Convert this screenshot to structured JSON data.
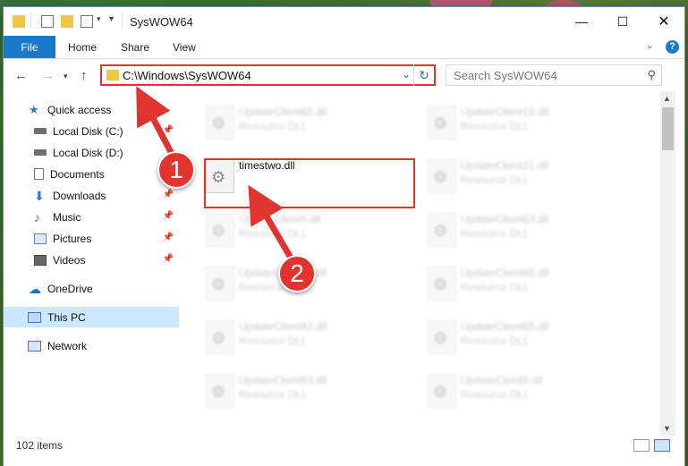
{
  "window": {
    "title": "SysWOW64"
  },
  "ribbon": {
    "tabs": [
      "File",
      "Home",
      "Share",
      "View"
    ]
  },
  "nav": {
    "address": "C:\\Windows\\SysWOW64",
    "search_placeholder": "Search SysWOW64"
  },
  "sidebar": {
    "items": [
      {
        "label": "Quick access",
        "icon": "star-icon"
      },
      {
        "label": "Local Disk (C:)",
        "icon": "drive-icon"
      },
      {
        "label": "Local Disk (D:)",
        "icon": "drive-icon"
      },
      {
        "label": "Documents",
        "icon": "documents-icon"
      },
      {
        "label": "Downloads",
        "icon": "downloads-icon"
      },
      {
        "label": "Music",
        "icon": "music-icon"
      },
      {
        "label": "Pictures",
        "icon": "pictures-icon"
      },
      {
        "label": "Videos",
        "icon": "videos-icon"
      },
      {
        "label": "OneDrive",
        "icon": "cloud-icon"
      },
      {
        "label": "This PC",
        "icon": "computer-icon"
      },
      {
        "label": "Network",
        "icon": "network-icon"
      }
    ]
  },
  "files": {
    "highlighted": {
      "name": "timestwo.dll",
      "type": ""
    },
    "left": [
      {
        "name": "UpdateClient65.dll",
        "type": "Resource DLL"
      },
      {
        "name": "timestwo.dll",
        "type": ""
      },
      {
        "name": "UpdateClient5.dll",
        "type": "Resource DLL"
      },
      {
        "name": "UpdateClient19.dll",
        "type": "Resource DLL"
      },
      {
        "name": "UpdateClient42.dll",
        "type": "Resource DLL"
      },
      {
        "name": "UpdateClient63.dll",
        "type": "Resource DLL"
      }
    ],
    "right": [
      {
        "name": "UpdateClient19.dll",
        "type": "Resource DLL"
      },
      {
        "name": "UpdateClient21.dll",
        "type": "Resource DLL"
      },
      {
        "name": "UpdateClient63.dll",
        "type": "Resource DLL"
      },
      {
        "name": "UpdateClient65.dll",
        "type": "Resource DLL"
      },
      {
        "name": "UpdateClient65.dll",
        "type": "Resource DLL"
      },
      {
        "name": "UpdateClient5.dll",
        "type": "Resource DLL"
      }
    ]
  },
  "status": {
    "count": "102 items"
  },
  "annotations": {
    "step1": "1",
    "step2": "2"
  },
  "colors": {
    "accent": "#1979ca",
    "annotation": "#e2342f",
    "selected": "#cce8ff"
  }
}
